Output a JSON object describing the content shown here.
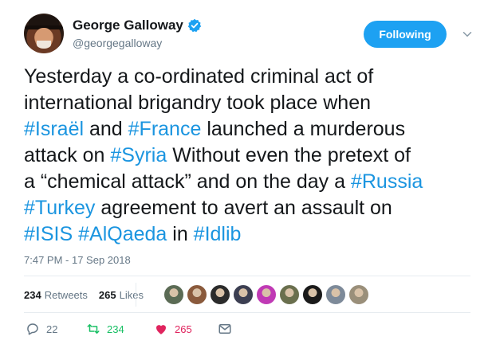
{
  "author": {
    "display_name": "George Galloway",
    "handle": "@georgegalloway",
    "verified": true
  },
  "follow_button": {
    "label": "Following"
  },
  "tweet": {
    "lines": [
      [
        {
          "t": "Yesterday a co-ordinated criminal act of"
        }
      ],
      [
        {
          "t": "international brigandry took place when"
        }
      ],
      [
        {
          "t": "#Israël",
          "tag": true
        },
        {
          "t": " and "
        },
        {
          "t": "#France",
          "tag": true
        },
        {
          "t": " launched a murderous"
        }
      ],
      [
        {
          "t": "attack on "
        },
        {
          "t": "#Syria",
          "tag": true
        },
        {
          "t": " Without even the pretext of"
        }
      ],
      [
        {
          "t": "a “chemical attack” and on the day a "
        },
        {
          "t": "#Russia",
          "tag": true
        }
      ],
      [
        {
          "t": "#Turkey",
          "tag": true
        },
        {
          "t": " agreement to avert an assault on"
        }
      ],
      [
        {
          "t": "#ISIS",
          "tag": true
        },
        {
          "t": " "
        },
        {
          "t": "#AlQaeda",
          "tag": true
        },
        {
          "t": " in "
        },
        {
          "t": "#Idlib",
          "tag": true
        }
      ]
    ],
    "timestamp": "7:47 PM - 17 Sep 2018"
  },
  "stats": {
    "retweets_count": "234",
    "retweets_label": "Retweets",
    "likes_count": "265",
    "likes_label": "Likes"
  },
  "likers": [
    "#5b6b55",
    "#8a5a3c",
    "#2b2b2b",
    "#3c3f52",
    "#c03ab5",
    "#6a6f4e",
    "#1a1a1a",
    "#7d8a99",
    "#9a8f7a"
  ],
  "actions": {
    "reply_count": "22",
    "retweet_count": "234",
    "like_count": "265"
  },
  "colors": {
    "accent": "#1da1f2",
    "hashtag": "#1b95e0",
    "retweet": "#17bf63",
    "like": "#e0245e",
    "muted": "#657786"
  }
}
